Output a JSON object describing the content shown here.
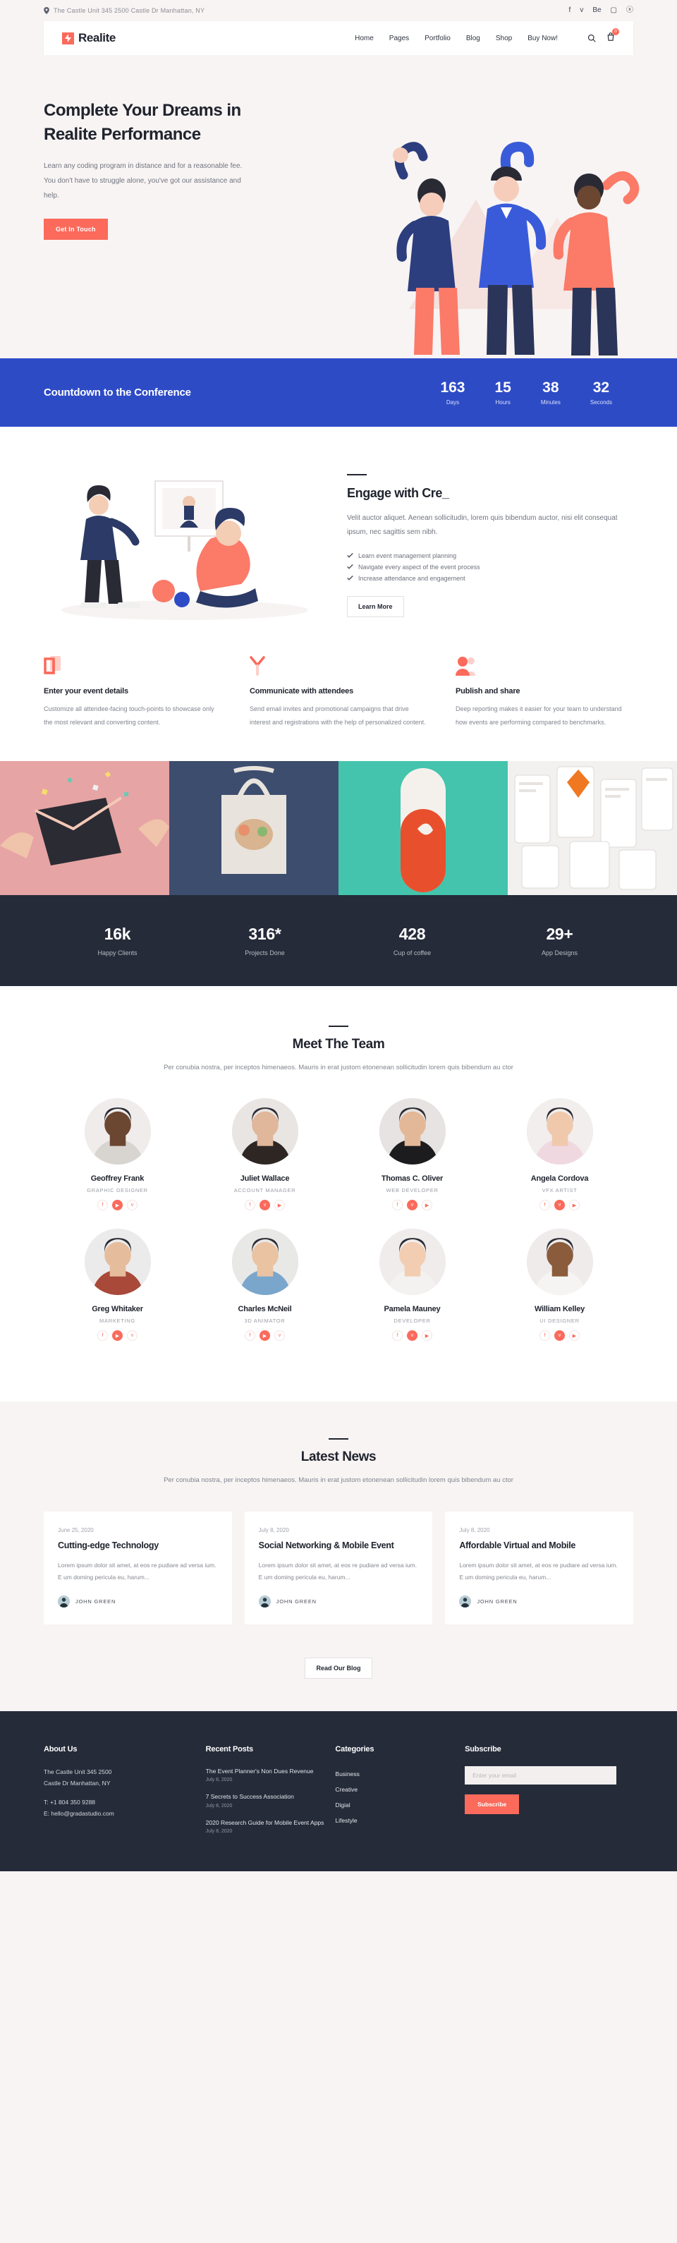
{
  "topbar": {
    "address": "The Castle Unit 345 2500 Castle Dr Manhattan, NY",
    "social": [
      {
        "name": "facebook-icon",
        "glyph": "f"
      },
      {
        "name": "twitter-icon",
        "glyph": "ᴠ"
      },
      {
        "name": "behance-icon",
        "glyph": "Be"
      },
      {
        "name": "instagram-icon",
        "glyph": "▢"
      },
      {
        "name": "dribbble-icon",
        "glyph": "ⓧ"
      }
    ]
  },
  "header": {
    "brand": "Realite",
    "nav": [
      "Home",
      "Pages",
      "Portfolio",
      "Blog",
      "Shop",
      "Buy Now!"
    ],
    "cart_count": "0"
  },
  "hero": {
    "title": "Complete Your Dreams in Realite Performance",
    "body": "Learn any coding program in distance and for a reasonable fee. You don't have to struggle alone, you've got our assistance and help.",
    "cta": "Get In Touch"
  },
  "countdown": {
    "title": "Countdown to the Conference",
    "items": [
      {
        "value": "163",
        "label": "Days"
      },
      {
        "value": "15",
        "label": "Hours"
      },
      {
        "value": "38",
        "label": "Minutes"
      },
      {
        "value": "32",
        "label": "Seconds"
      }
    ]
  },
  "engage": {
    "title": "Engage with Cre_",
    "body": "Velit auctor aliquet. Aenean sollicitudin, lorem quis bibendum auctor, nisi elit consequat ipsum, nec sagittis sem nibh.",
    "ticks": [
      "Learn event management planning",
      "Navigate every aspect of the event process",
      "Increase attendance and engagement"
    ],
    "cta": "Learn More"
  },
  "features": [
    {
      "icon": "card-stack-icon",
      "title": "Enter your event details",
      "body": "Customize all attendee-facing touch-points to showcase only the most relevant and converting content."
    },
    {
      "icon": "megaphone-icon",
      "title": "Communicate with attendees",
      "body": "Send email invites and promotional campaigns that drive interest and registrations with the help of personalized content."
    },
    {
      "icon": "people-icon",
      "title": "Publish and share",
      "body": "Deep reporting makes it easier for your team to understand how events are performing compared to benchmarks."
    }
  ],
  "gallery": [
    {
      "name": "envelope-confetti-photo",
      "color": "#e7a4a4"
    },
    {
      "name": "tote-bag-photo",
      "color": "#3d4d6e"
    },
    {
      "name": "bottle-product-photo",
      "color": "#44c4ac"
    },
    {
      "name": "app-screens-photo",
      "color": "#f0f0ee"
    }
  ],
  "stats": [
    {
      "value": "16k",
      "label": "Happy Clients"
    },
    {
      "value": "316*",
      "label": "Projects Done"
    },
    {
      "value": "428",
      "label": "Cup of coffee"
    },
    {
      "value": "29+",
      "label": "App Designs"
    }
  ],
  "team": {
    "title": "Meet The Team",
    "subtitle": "Per conubia nostra, per inceptos himenaeos. Mauris in erat justom etonenean sollicitudin lorem quis bibendum au ctor",
    "members": [
      {
        "name": "Geoffrey Frank",
        "role": "GRAPHIC DESIGNER",
        "skin": "#6b4631",
        "shirt": "#d8d4d0",
        "bg": "#efeceb",
        "socials": [
          "f",
          "▶",
          "ᴠ"
        ]
      },
      {
        "name": "Juliet Wallace",
        "role": "ACCOUNT MANAGER",
        "skin": "#e0b79b",
        "shirt": "#2d2623",
        "bg": "#e9e5e3",
        "socials": [
          "f",
          "ᴠ",
          "▶"
        ]
      },
      {
        "name": "Thomas C. Oliver",
        "role": "WEB DEVELOPER",
        "skin": "#e3b898",
        "shirt": "#1c1c1e",
        "bg": "#e6e3e2",
        "socials": [
          "f",
          "ᴠ",
          "▶"
        ]
      },
      {
        "name": "Angela Cordova",
        "role": "VFX ARTIST",
        "skin": "#f0c9ad",
        "shirt": "#f0d8e0",
        "bg": "#f2eeee",
        "socials": [
          "f",
          "ᴠ",
          "▶"
        ]
      },
      {
        "name": "Greg Whitaker",
        "role": "MARKETING",
        "skin": "#e6bd9c",
        "shirt": "#a8493a",
        "bg": "#ecebeb",
        "socials": [
          "f",
          "▶",
          "ᴠ"
        ]
      },
      {
        "name": "Charles McNeil",
        "role": "3D ANIMATOR",
        "skin": "#eac3a2",
        "shirt": "#7aa6cc",
        "bg": "#e8e8e6",
        "socials": [
          "f",
          "▶",
          "ᴠ"
        ]
      },
      {
        "name": "Pamela Mauney",
        "role": "DEVELOPER",
        "skin": "#f2cdb2",
        "shirt": "#f4f2f0",
        "bg": "#efeceb",
        "socials": [
          "f",
          "ᴠ",
          "▶"
        ]
      },
      {
        "name": "William Kelley",
        "role": "UI DESIGNER",
        "skin": "#8a5c3c",
        "shirt": "#f5f4f2",
        "bg": "#eeebea",
        "socials": [
          "f",
          "ᴠ",
          "▶"
        ]
      }
    ]
  },
  "news": {
    "title": "Latest News",
    "subtitle": "Per conubia nostra, per inceptos himenaeos. Mauris in erat justom etonenean sollicitudin lorem quis bibendum au ctor",
    "cta": "Read Our Blog",
    "posts": [
      {
        "date": "June 25, 2020",
        "title": "Cutting-edge Technology",
        "excerpt": "Lorem ipsum dolor sit amet, at eos re pudiare ad versa ium. E um doming pericula eu, harum...",
        "author": "JOHN GREEN"
      },
      {
        "date": "July 8, 2020",
        "title": "Social Networking & Mobile Event",
        "excerpt": "Lorem ipsum dolor sit amet, at eos re pudiare ad versa ium. E um doming pericula eu, harum...",
        "author": "JOHN GREEN"
      },
      {
        "date": "July 8, 2020",
        "title": "Affordable Virtual and Mobile",
        "excerpt": "Lorem ipsum dolor sit amet, at eos re pudiare ad versa ium. E um doming pericula eu, harum...",
        "author": "JOHN GREEN"
      }
    ]
  },
  "footer": {
    "about": {
      "title": "About Us",
      "address_1": "The Castle Unit 345 2500",
      "address_2": "Castle Dr Manhattan, NY",
      "phone": "T: +1 804 350 9288",
      "email": "E: hello@gradastudio.com"
    },
    "recent": {
      "title": "Recent Posts",
      "posts": [
        {
          "title": "The Event Planner's Non Dues Revenue",
          "date": "July 8, 2020"
        },
        {
          "title": "7 Secrets to Success Association",
          "date": "July 8, 2020"
        },
        {
          "title": "2020 Research Guide for Mobile Event Apps",
          "date": "July 8, 2020"
        }
      ]
    },
    "categories": {
      "title": "Categories",
      "items": [
        "Business",
        "Creative",
        "Digial",
        "Lifestyle"
      ]
    },
    "subscribe": {
      "title": "Subscribe",
      "placeholder": "Enter your email",
      "value": "",
      "button": "Subscribe"
    }
  },
  "colors": {
    "accent": "#fb6a5b",
    "blue": "#2e4bc6",
    "dark": "#252b39",
    "page_bg": "#f8f4f3"
  }
}
